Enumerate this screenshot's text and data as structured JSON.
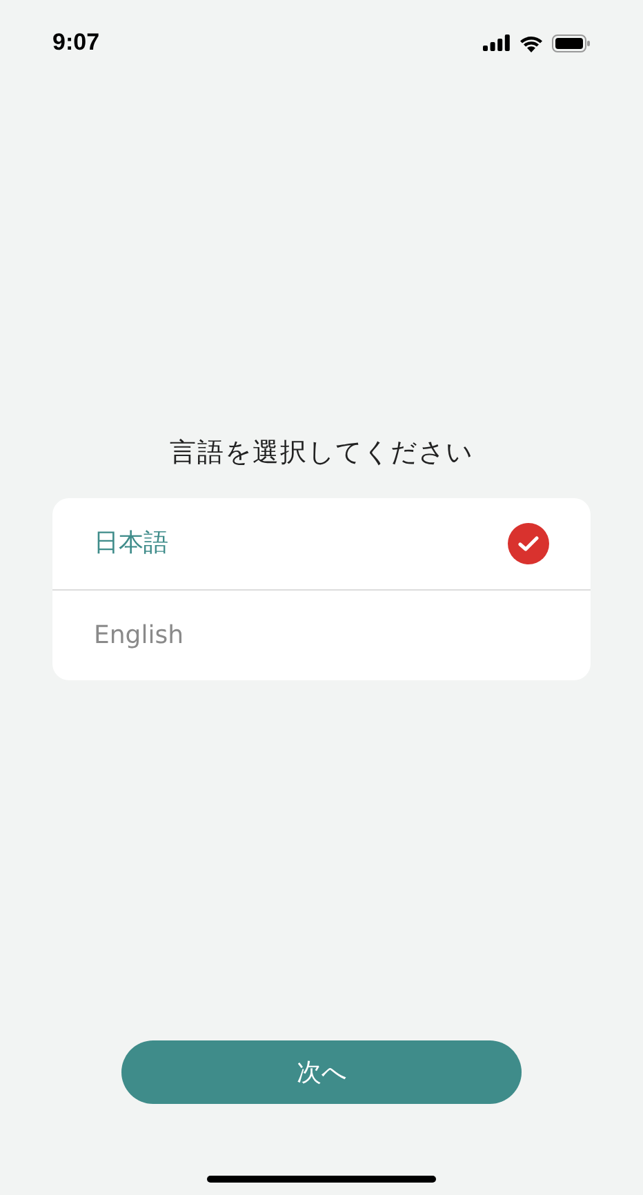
{
  "status_bar": {
    "time": "9:07"
  },
  "title": "言語を選択してください",
  "languages": [
    {
      "label": "日本語",
      "selected": true
    },
    {
      "label": "English",
      "selected": false
    }
  ],
  "next_button": "次へ"
}
